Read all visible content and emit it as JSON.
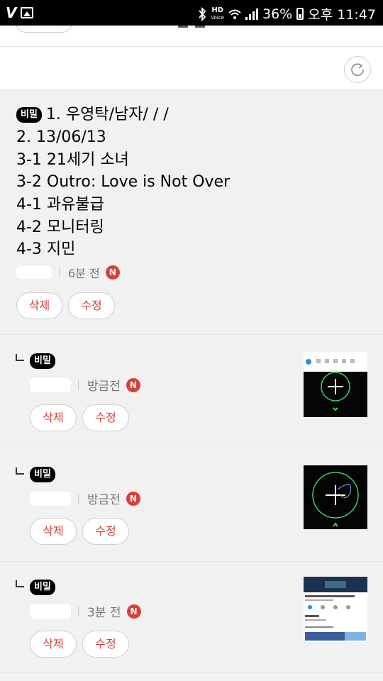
{
  "status_bar": {
    "app_icon": "V",
    "hd_label": "HD",
    "voice_label": "Voice",
    "battery": "36%",
    "time": "오후 11:47",
    "icons": [
      "bluetooth-icon",
      "wifi-icon",
      "signal-icon",
      "battery-icon",
      "gallery-icon"
    ]
  },
  "main_comment": {
    "badge": "비밀",
    "lines": [
      "1. 우영탁/남자/     /      /",
      "2. 13/06/13",
      "3-1 21세기 소녀",
      "3-2 Outro: Love is Not Over",
      "4-1 과유불급",
      "4-2 모니터링",
      "4-3 지민"
    ],
    "time": "6분 전",
    "new_badge": "N",
    "delete_label": "삭제",
    "edit_label": "수정"
  },
  "replies": [
    {
      "badge": "비밀",
      "time": "방금전",
      "new_badge": "N",
      "delete_label": "삭제",
      "edit_label": "수정"
    },
    {
      "badge": "비밀",
      "time": "방금전",
      "new_badge": "N",
      "delete_label": "삭제",
      "edit_label": "수정"
    },
    {
      "badge": "비밀",
      "time": "3분 전",
      "new_badge": "N",
      "delete_label": "삭제",
      "edit_label": "수정"
    }
  ],
  "colors": {
    "accent": "#d8413a",
    "badge_bg": "#000000",
    "background": "#f1f1f1"
  }
}
